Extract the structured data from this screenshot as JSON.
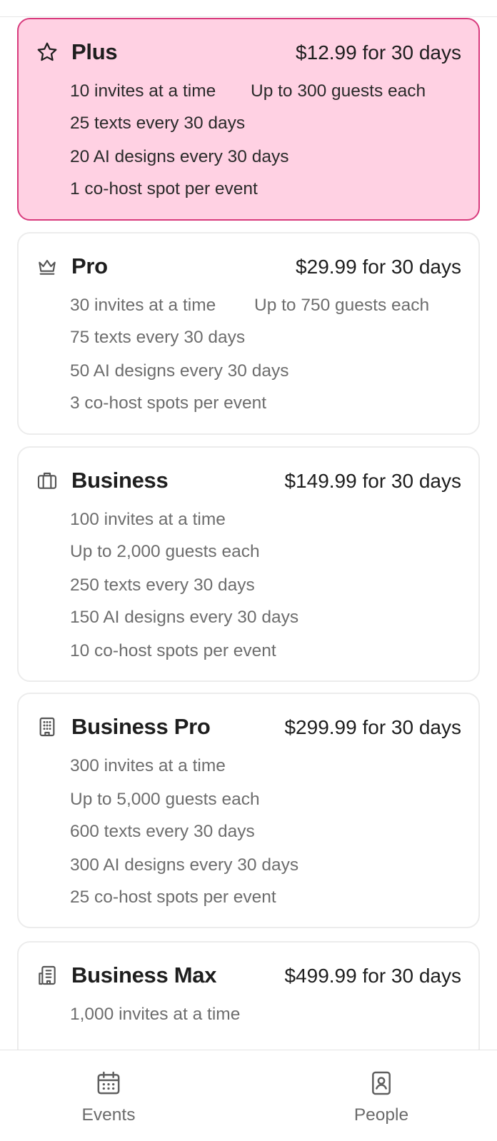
{
  "plans": [
    {
      "name": "Plus",
      "price": "$12.99 for 30 days",
      "icon": "star-icon",
      "selected": true,
      "features": [
        "10 invites at a time",
        "Up to 300 guests each",
        "25 texts every 30 days",
        "20 AI designs every 30 days",
        "1 co-host spot per event"
      ]
    },
    {
      "name": "Pro",
      "price": "$29.99 for 30 days",
      "icon": "crown-icon",
      "selected": false,
      "features": [
        "30 invites at a time",
        "Up to 750 guests each",
        "75 texts every 30 days",
        "50 AI designs every 30 days",
        "3 co-host spots per event"
      ]
    },
    {
      "name": "Business",
      "price": "$149.99 for 30 days",
      "icon": "briefcase-icon",
      "selected": false,
      "features": [
        "100 invites at a time",
        "Up to 2,000 guests each",
        "250 texts every 30 days",
        "150 AI designs every 30 days",
        "10 co-host spots per event"
      ]
    },
    {
      "name": "Business Pro",
      "price": "$299.99 for 30 days",
      "icon": "office-building-icon",
      "selected": false,
      "features": [
        "300 invites at a time",
        "Up to 5,000 guests each",
        "600 texts every 30 days",
        "300 AI designs every 30 days",
        "25 co-host spots per event"
      ]
    },
    {
      "name": "Business Max",
      "price": "$499.99 for 30 days",
      "icon": "buildings-icon",
      "selected": false,
      "features": [
        "1,000 invites at a time"
      ]
    }
  ],
  "tabbar": {
    "events_label": "Events",
    "events_icon": "calendar-icon",
    "people_label": "People",
    "people_icon": "contacts-book-icon"
  },
  "colors": {
    "selected_bg": "#ffd1e3",
    "selected_border": "#d83b7d",
    "card_border": "#ececec",
    "muted_text": "#6d6d6d"
  }
}
